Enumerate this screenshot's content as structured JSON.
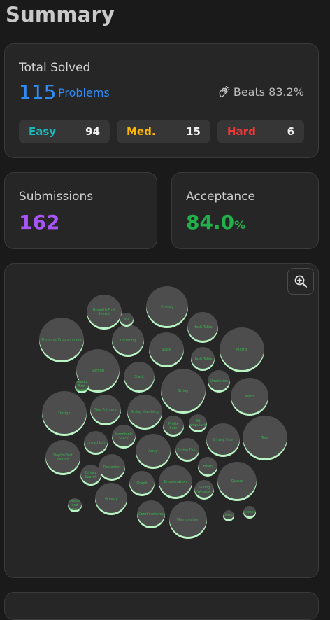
{
  "page": {
    "title": "Summary"
  },
  "total": {
    "label": "Total Solved",
    "count": "115",
    "unit": "Problems",
    "beats": "Beats 83.2%",
    "difficulties": [
      {
        "name": "Easy",
        "count": "94",
        "color": "#1cbaba"
      },
      {
        "name": "Med.",
        "count": "15",
        "color": "#ffb700"
      },
      {
        "name": "Hard",
        "count": "6",
        "color": "#f63737"
      }
    ]
  },
  "submissions": {
    "label": "Submissions",
    "value": "162",
    "color": "#a855f7"
  },
  "acceptance": {
    "label": "Acceptance",
    "value": "84.0",
    "unit": "%",
    "color": "#22b04b"
  },
  "topics": {
    "zoom_icon": "zoom-in-icon",
    "bubble_color": "#4d4d4d",
    "label_color": "#37b24d",
    "fill_color": "#b9f5c4",
    "items": [
      "Breadth-First Search",
      "Greedy",
      "Dynamic Programming",
      "Hash Table",
      "Counting",
      "Stack",
      "Matrix",
      "Hash Table",
      "Sorting",
      "Stack",
      "Simulation",
      "String",
      "Math",
      "Design",
      "Two Pointers",
      "String Matching",
      "Prefix Sum",
      "Bit Manipulation",
      "Binary Tree",
      "Tree",
      "Linked List",
      "Monotonic Stack",
      "Array",
      "Union Find",
      "Depth-First Search",
      "Recursion",
      "Binary Search",
      "Heap",
      "Queue",
      "Graph",
      "Enumeration",
      "Sliding Window",
      "Greedy",
      "Combinatorics",
      "Memoization",
      "Trie",
      "Breadth-First Search",
      "Geometry",
      "Backtracking",
      "Divide and Conquer"
    ]
  }
}
